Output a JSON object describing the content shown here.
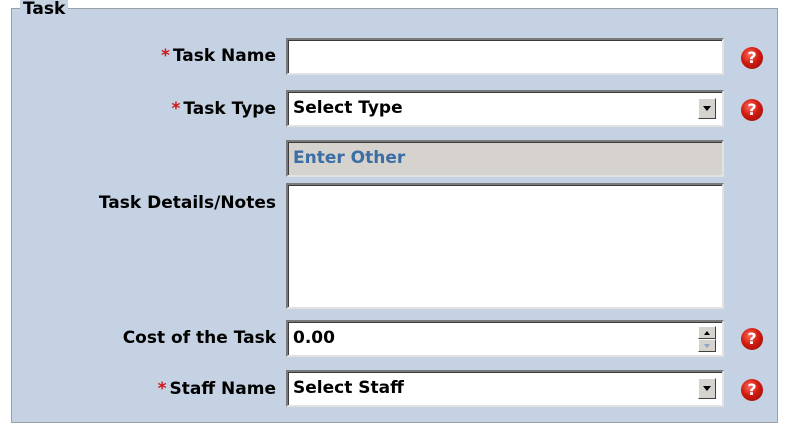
{
  "fieldset": {
    "legend": "Task"
  },
  "fields": {
    "task_name": {
      "required_mark": "*",
      "label": "Task Name",
      "value": ""
    },
    "task_type": {
      "required_mark": "*",
      "label": "Task Type",
      "selected": "Select Type"
    },
    "enter_other": {
      "value": "Enter Other"
    },
    "task_details": {
      "label": "Task Details/Notes",
      "value": ""
    },
    "cost": {
      "label": "Cost of the Task",
      "value": "0.00"
    },
    "staff_name": {
      "required_mark": "*",
      "label": "Staff Name",
      "selected": "Select Staff"
    }
  },
  "help_icon_glyph": "?",
  "colors": {
    "panel_bg": "#c4d2e3",
    "required": "#d11515",
    "disabled_text": "#3a6ea5",
    "help_icon": "#d21b10"
  },
  "icons": {
    "help": "help-question-icon",
    "dropdown": "chevron-down-icon",
    "spin_up": "spin-up-icon",
    "spin_down": "spin-down-icon"
  }
}
